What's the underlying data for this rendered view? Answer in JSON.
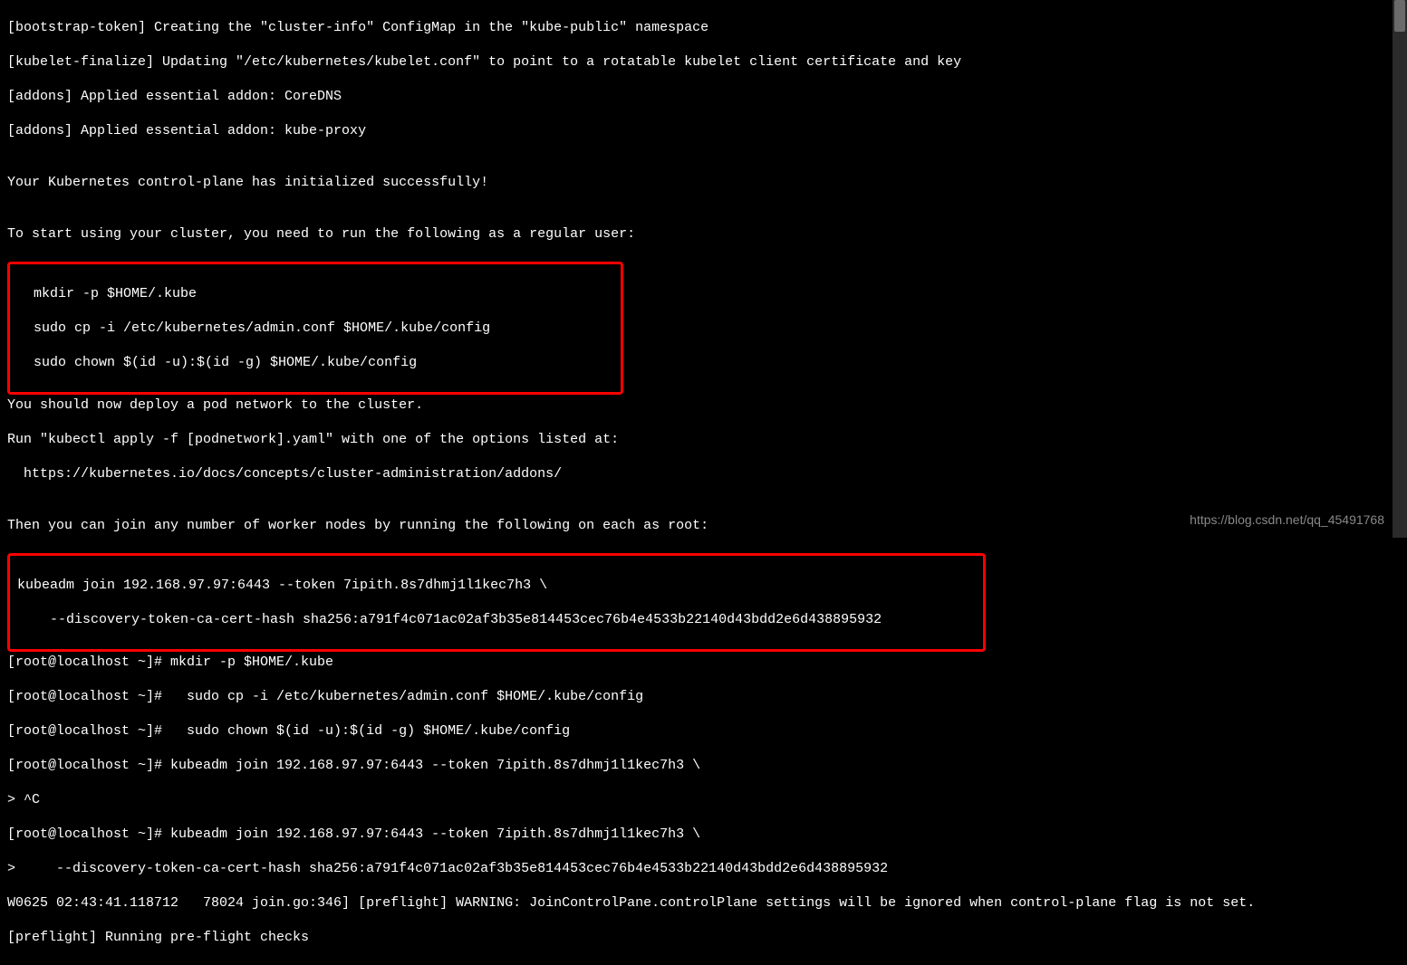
{
  "lines": {
    "l1": "[bootstrap-token] Creating the \"cluster-info\" ConfigMap in the \"kube-public\" namespace",
    "l2": "[kubelet-finalize] Updating \"/etc/kubernetes/kubelet.conf\" to point to a rotatable kubelet client certificate and key",
    "l3": "[addons] Applied essential addon: CoreDNS",
    "l4": "[addons] Applied essential addon: kube-proxy",
    "l5": "",
    "l6": "Your Kubernetes control-plane has initialized successfully!",
    "l7": "",
    "l8": "To start using your cluster, you need to run the following as a regular user:",
    "l9": "",
    "box1_l1": "  mkdir -p $HOME/.kube",
    "box1_l2": "  sudo cp -i /etc/kubernetes/admin.conf $HOME/.kube/config",
    "box1_l3": "  sudo chown $(id -u):$(id -g) $HOME/.kube/config",
    "l10": "",
    "l11": "You should now deploy a pod network to the cluster.",
    "l12": "Run \"kubectl apply -f [podnetwork].yaml\" with one of the options listed at:",
    "l13": "  https://kubernetes.io/docs/concepts/cluster-administration/addons/",
    "l14": "",
    "l15": "Then you can join any number of worker nodes by running the following on each as root:",
    "l16": "",
    "box2_l1": "kubeadm join 192.168.97.97:6443 --token 7ipith.8s7dhmj1l1kec7h3 \\",
    "box2_l2": "    --discovery-token-ca-cert-hash sha256:a791f4c071ac02af3b35e814453cec76b4e4533b22140d43bdd2e6d438895932",
    "l17": "[root@localhost ~]# mkdir -p $HOME/.kube",
    "l18": "[root@localhost ~]#   sudo cp -i /etc/kubernetes/admin.conf $HOME/.kube/config",
    "l19": "[root@localhost ~]#   sudo chown $(id -u):$(id -g) $HOME/.kube/config",
    "l20": "[root@localhost ~]# kubeadm join 192.168.97.97:6443 --token 7ipith.8s7dhmj1l1kec7h3 \\",
    "l21": "> ^C",
    "l22": "[root@localhost ~]# kubeadm join 192.168.97.97:6443 --token 7ipith.8s7dhmj1l1kec7h3 \\",
    "l23": ">     --discovery-token-ca-cert-hash sha256:a791f4c071ac02af3b35e814453cec76b4e4533b22140d43bdd2e6d438895932",
    "l24": "W0625 02:43:41.118712   78024 join.go:346] [preflight] WARNING: JoinControlPane.controlPlane settings will be ignored when control-plane flag is not set.",
    "l25": "[preflight] Running pre-flight checks"
  },
  "watermark": "https://blog.csdn.net/qq_45491768"
}
